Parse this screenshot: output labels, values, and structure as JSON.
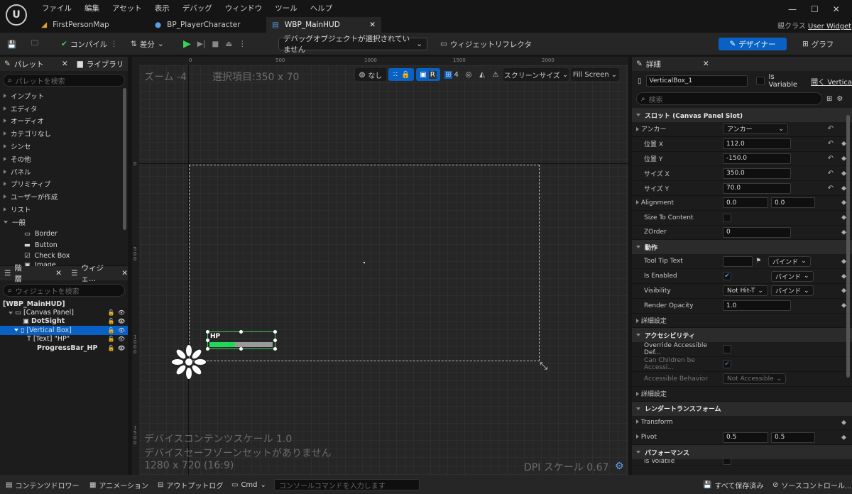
{
  "menu": [
    "ファイル",
    "編集",
    "アセット",
    "表示",
    "デバッグ",
    "ウィンドウ",
    "ツール",
    "ヘルプ"
  ],
  "tabs": [
    "FirstPersonMap",
    "BP_PlayerCharacter",
    "WBP_MainHUD"
  ],
  "parent_class": {
    "label": "親クラス",
    "value": "User Widget"
  },
  "toolbar": {
    "compile": "コンパイル",
    "diff": "差分",
    "debug_object": "デバッグオブジェクトが選択されていません",
    "reflector": "ウィジェットリフレクタ",
    "designer": "デザイナー",
    "graph": "グラフ"
  },
  "palette": {
    "tab_palette": "パレット",
    "tab_library": "ライブラリ",
    "search_placeholder": "パレットを検索",
    "categories": [
      "インプット",
      "エディタ",
      "オーディオ",
      "カテゴリなし",
      "シンセ",
      "その他",
      "パネル",
      "プリミティブ",
      "ユーザーが作成",
      "リスト"
    ],
    "general": "一般",
    "items": [
      "Border",
      "Button",
      "Check Box",
      "Image"
    ]
  },
  "hierarchy": {
    "tab_hierarchy": "階層",
    "tab_widget": "ウィジェ...",
    "search_placeholder": "ウィジェットを検索",
    "root": "[WBP_MainHUD]",
    "canvas": "[Canvas Panel]",
    "dot": "DotSight",
    "vbox": "[Vertical Box]",
    "text": "[Text] \"HP\"",
    "progress": "ProgressBar_HP"
  },
  "viewport": {
    "zoom": "ズーム -4",
    "selection": "選択項目:350 x 70",
    "none": "なし",
    "r": "R",
    "grid": "4",
    "screen_size": "スクリーンサイズ",
    "fill": "Fill Screen",
    "ruler_top": [
      "0",
      "500",
      "1000",
      "1500",
      "2000"
    ],
    "ruler_left": [
      "0",
      "5\n0\n0",
      "1\n0\n0\n0",
      "1\n5\n0\n0"
    ],
    "hp_label": "HP",
    "progress_fill": 0.4,
    "footer1": "デバイスコンテンツスケール 1.0",
    "footer2": "デバイスセーフゾーンセットがありません",
    "footer3": "1280 x 720 (16:9)",
    "dpi": "DPI スケール 0.67"
  },
  "details": {
    "title": "詳細",
    "name": "VerticalBox_1",
    "is_variable": "Is Variable",
    "open": "開く Vertica",
    "search_placeholder": "検索",
    "slot_section": "スロット (Canvas Panel Slot)",
    "anchor_label": "アンカー",
    "anchor_value": "アンカー",
    "pos_x_label": "位置 X",
    "pos_x": "112.0",
    "pos_y_label": "位置 Y",
    "pos_y": "-150.0",
    "size_x_label": "サイズ X",
    "size_x": "350.0",
    "size_y_label": "サイズ Y",
    "size_y": "70.0",
    "alignment_label": "Alignment",
    "align_x": "0.0",
    "align_y": "0.0",
    "size_content_label": "Size To Content",
    "zorder_label": "ZOrder",
    "zorder": "0",
    "behavior_section": "動作",
    "tooltip_label": "Tool Tip Text",
    "bind": "バインド",
    "enabled_label": "Is Enabled",
    "visibility_label": "Visibility",
    "visibility_value": "Not Hit-T",
    "opacity_label": "Render Opacity",
    "opacity": "1.0",
    "advanced": "詳細設定",
    "access_section": "アクセシビリティ",
    "override_label": "Override Accessible Def...",
    "children_label": "Can Children be Accessi...",
    "acc_behavior_label": "Accessible Behavior",
    "acc_behavior_value": "Not Accessible",
    "render_section": "レンダートランスフォーム",
    "transform_label": "Transform",
    "pivot_label": "Pivot",
    "pivot_x": "0.5",
    "pivot_y": "0.5",
    "perf_section": "パフォーマンス",
    "volatile_label": "Is Volatile"
  },
  "bottom": {
    "content_drawer": "コンテンツドロワー",
    "animation": "アニメーション",
    "output_log": "アウトプットログ",
    "cmd": "Cmd",
    "console_placeholder": "コンソールコマンドを入力します",
    "save_all": "すべて保存済み",
    "source_control": "ソースコントロール..."
  }
}
